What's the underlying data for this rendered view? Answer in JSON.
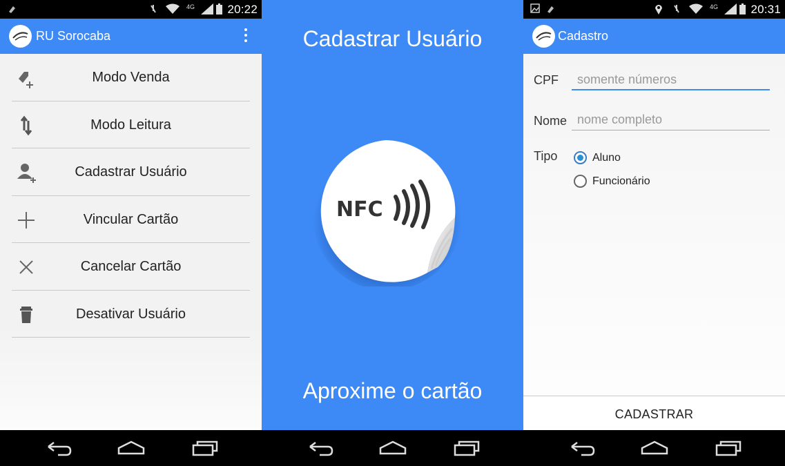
{
  "screen1": {
    "status_time": "20:22",
    "status_signal_label": "4G",
    "app_title": "RU Sorocaba",
    "menu": [
      {
        "label": "Modo Venda",
        "icon": "tag-add-icon"
      },
      {
        "label": "Modo Leitura",
        "icon": "transfer-arrows-icon"
      },
      {
        "label": "Cadastrar Usuário",
        "icon": "add-user-icon"
      },
      {
        "label": "Vincular Cartão",
        "icon": "plus-icon"
      },
      {
        "label": "Cancelar Cartão",
        "icon": "close-icon"
      },
      {
        "label": "Desativar Usuário",
        "icon": "trash-icon"
      }
    ]
  },
  "screen2": {
    "title": "Cadastrar Usuário",
    "nfc_label": "NFC",
    "instruction": "Aproxime o cartão"
  },
  "screen3": {
    "status_time": "20:31",
    "status_signal_label": "4G",
    "app_title": "Cadastro",
    "cpf_label": "CPF",
    "cpf_placeholder": "somente números",
    "nome_label": "Nome",
    "nome_placeholder": "nome completo",
    "tipo_label": "Tipo",
    "tipo_options": [
      "Aluno",
      "Funcionário"
    ],
    "tipo_selected": "Aluno",
    "submit_label": "CADASTRAR"
  },
  "colors": {
    "accent": "#3d8af7",
    "radio_selected": "#2a90d4"
  }
}
